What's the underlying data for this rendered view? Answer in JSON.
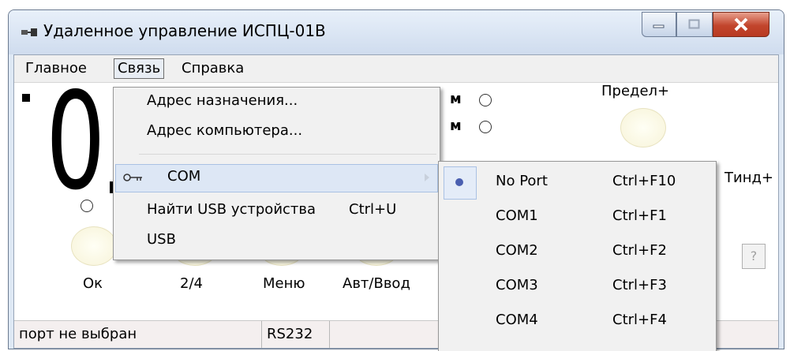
{
  "window": {
    "title": "Удаленное управление ИСПЦ-01В",
    "controls": [
      "minimize",
      "maximize",
      "close"
    ]
  },
  "menubar": {
    "items": [
      "Главное",
      "Связь",
      "Справка"
    ],
    "active": "Связь"
  },
  "panel": {
    "display_digits": [
      "0",
      "."
    ],
    "partial_labels": [
      "м",
      "м"
    ],
    "limit_plus": "Предел+",
    "tind_plus": "Тинд+",
    "help_button": "?",
    "buttons": [
      "Ок",
      "2/4",
      "Меню",
      "Авт/Ввод"
    ]
  },
  "svyaz_menu": {
    "items": [
      {
        "label": "Адрес назначения...",
        "shortcut": ""
      },
      {
        "label": "Адрес компьютера...",
        "shortcut": ""
      },
      {
        "label": "COM",
        "shortcut": "",
        "has_submenu": true,
        "icon": "key-icon",
        "highlighted": true
      },
      {
        "label": "Найти USB устройства",
        "shortcut": "Ctrl+U"
      },
      {
        "label": "USB",
        "shortcut": ""
      }
    ]
  },
  "com_submenu": {
    "items": [
      {
        "label": "No Port",
        "shortcut": "Ctrl+F10",
        "selected": true
      },
      {
        "label": "COM1",
        "shortcut": "Ctrl+F1"
      },
      {
        "label": "COM2",
        "shortcut": "Ctrl+F2"
      },
      {
        "label": "COM3",
        "shortcut": "Ctrl+F3"
      },
      {
        "label": "COM4",
        "shortcut": "Ctrl+F4"
      }
    ]
  },
  "statusbar": {
    "port": "порт не выбран",
    "interface": "RS232"
  }
}
